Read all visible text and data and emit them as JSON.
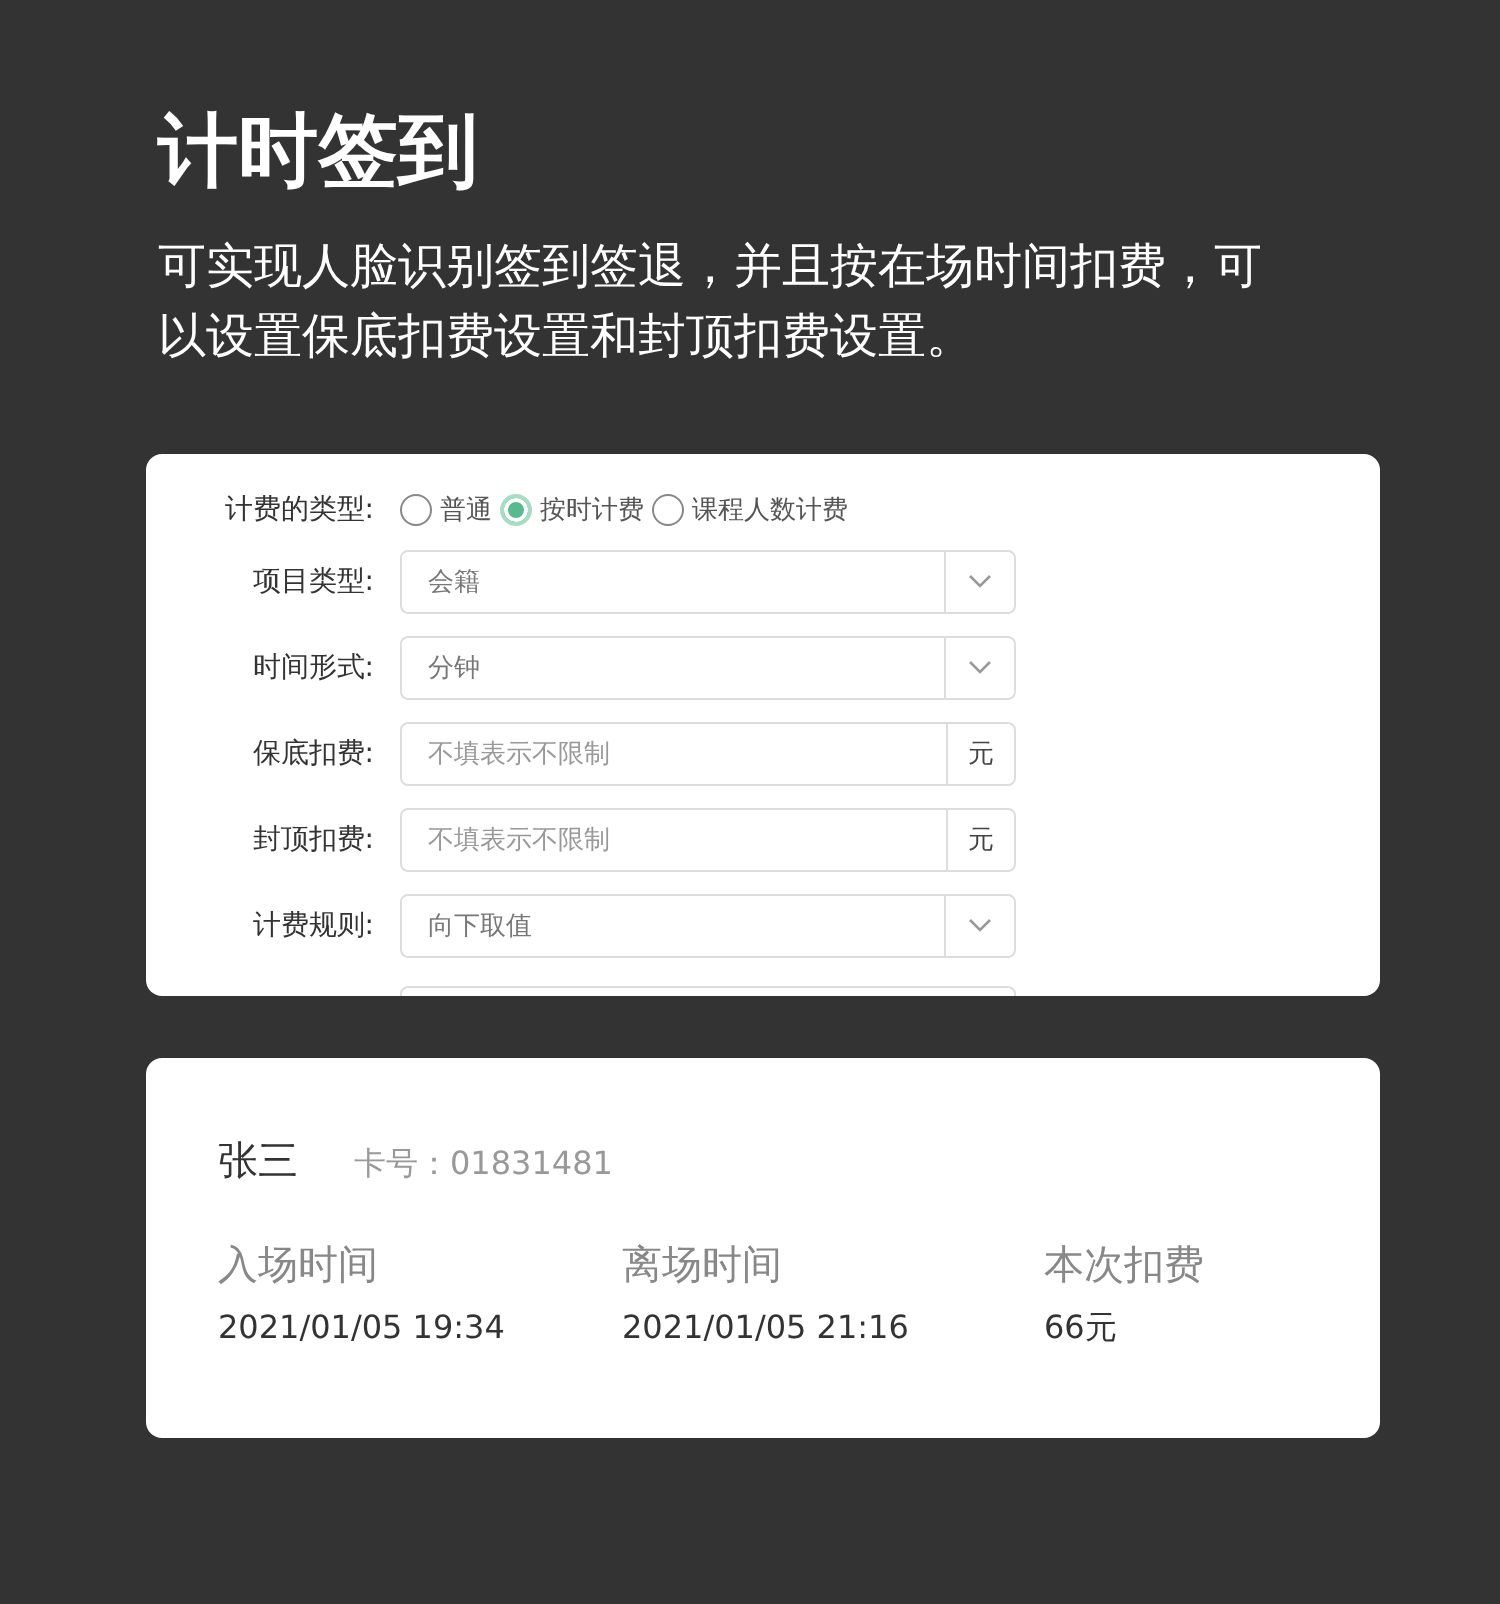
{
  "title": "计时签到",
  "description": "可实现人脸识别签到签退，并且按在场时间扣费，可以设置保底扣费设置和封顶扣费设置。",
  "form": {
    "billing_type": {
      "label": "计费的类型:",
      "options": [
        {
          "label": "普通",
          "selected": false
        },
        {
          "label": "按时计费",
          "selected": true
        },
        {
          "label": "课程人数计费",
          "selected": false
        }
      ]
    },
    "fields": [
      {
        "kind": "select",
        "label": "项目类型:",
        "value": "会籍"
      },
      {
        "kind": "select",
        "label": "时间形式:",
        "value": "分钟"
      },
      {
        "kind": "unit",
        "label": "保底扣费:",
        "placeholder": "不填表示不限制",
        "unit": "元"
      },
      {
        "kind": "unit",
        "label": "封顶扣费:",
        "placeholder": "不填表示不限制",
        "unit": "元"
      },
      {
        "kind": "select",
        "label": "计费规则:",
        "value": "向下取值"
      }
    ]
  },
  "record": {
    "name": "张三",
    "card_label": "卡号：",
    "card_number": "01831481",
    "columns": [
      {
        "label": "入场时间",
        "value": "2021/01/05 19:34"
      },
      {
        "label": "离场时间",
        "value": "2021/01/05 21:16"
      },
      {
        "label": "本次扣费",
        "value": "66元"
      }
    ]
  }
}
